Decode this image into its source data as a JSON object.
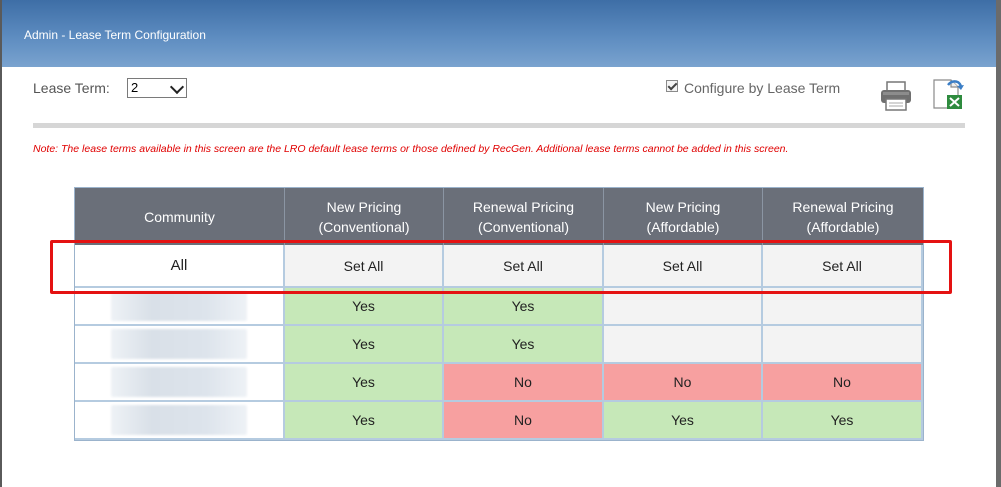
{
  "window": {
    "title": "Admin - Lease Term Configuration"
  },
  "toolbar": {
    "lease_term_label": "Lease Term:",
    "lease_term_value": "2",
    "configure_by_lease_term_label": "Configure by Lease Term",
    "configure_by_lease_term_checked": true,
    "print_icon": "printer-icon",
    "export_icon": "excel-export-icon"
  },
  "note": "Note: The lease terms available in this screen are the LRO default lease terms or those defined by RecGen. Additional lease terms cannot be added in this screen.",
  "table": {
    "headers": {
      "community": "Community",
      "new_conv": [
        "New Pricing",
        "(Conventional)"
      ],
      "renewal_conv": [
        "Renewal Pricing",
        "(Conventional)"
      ],
      "new_aff": [
        "New Pricing",
        "(Affordable)"
      ],
      "renewal_aff": [
        "Renewal Pricing",
        "(Affordable)"
      ]
    },
    "all_row": {
      "community": "All",
      "set_all": "Set All"
    },
    "rows": [
      {
        "new_conv": "Yes",
        "renewal_conv": "Yes",
        "new_aff": "",
        "renewal_aff": ""
      },
      {
        "new_conv": "Yes",
        "renewal_conv": "Yes",
        "new_aff": "",
        "renewal_aff": ""
      },
      {
        "new_conv": "Yes",
        "renewal_conv": "No",
        "new_aff": "No",
        "renewal_aff": "No"
      },
      {
        "new_conv": "Yes",
        "renewal_conv": "No",
        "new_aff": "Yes",
        "renewal_aff": "Yes"
      }
    ]
  },
  "colors": {
    "yes_bg": "#c6e8b8",
    "no_bg": "#f7a0a0",
    "empty_bg": "#f3f3f3",
    "highlight_border": "#e41212",
    "header_bg": "#6a6f79",
    "title_bar": "#4f7fb5"
  }
}
